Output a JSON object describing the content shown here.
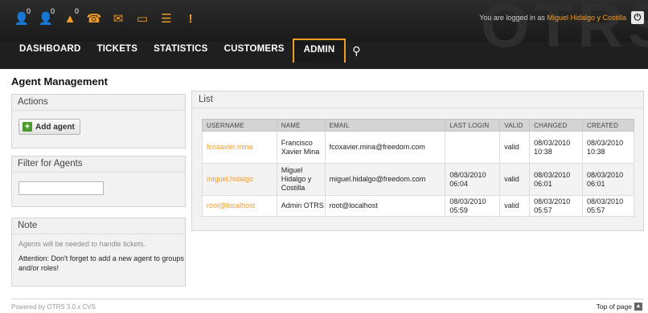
{
  "header": {
    "watermark": "OTRS",
    "login_prefix": "You are logged in as",
    "login_user": "Miguel Hidalgo y Costilla",
    "logout_icon": "power-icon",
    "toolbar": [
      {
        "icon": "locked-tickets-icon",
        "glyph": "👤",
        "count": "0"
      },
      {
        "icon": "watched-tickets-icon",
        "glyph": "👤",
        "count": "0"
      },
      {
        "icon": "responsible-tickets-icon",
        "glyph": "▲",
        "count": "0"
      },
      {
        "icon": "phone-ticket-icon",
        "glyph": "☎",
        "count": ""
      },
      {
        "icon": "email-ticket-icon",
        "glyph": "✉",
        "count": ""
      },
      {
        "icon": "ticket-search-icon",
        "glyph": "▭",
        "count": ""
      },
      {
        "icon": "queue-view-icon",
        "glyph": "☰",
        "count": ""
      },
      {
        "icon": "escalation-icon",
        "glyph": "!",
        "count": ""
      }
    ]
  },
  "nav": {
    "items": [
      "DASHBOARD",
      "TICKETS",
      "STATISTICS",
      "CUSTOMERS",
      "ADMIN"
    ],
    "selected": "ADMIN",
    "search_icon": "search-icon"
  },
  "page": {
    "title": "Agent Management"
  },
  "sidebar": {
    "actions_title": "Actions",
    "add_agent_label": "Add agent",
    "filter_title": "Filter for Agents",
    "filter_value": "",
    "note_title": "Note",
    "note_text": "Agents will be needed to handle tickets.",
    "note_attention": "Attention: Don't forget to add a new agent to groups and/or roles!"
  },
  "list": {
    "title": "List",
    "columns": [
      "USERNAME",
      "NAME",
      "EMAIL",
      "LAST LOGIN",
      "VALID",
      "CHANGED",
      "CREATED"
    ],
    "rows": [
      {
        "username": "fcoxavier.mina",
        "name": "Francisco Xavier Mina",
        "email": "fcoxavier.mina@freedom.com",
        "last_login": "",
        "valid": "valid",
        "changed": "08/03/2010 10:38",
        "created": "08/03/2010 10:38"
      },
      {
        "username": "miguel.hidalgo",
        "name": "Miguel Hidalgo y Costilla",
        "email": "miguel.hidalgo@freedom.com",
        "last_login": "08/03/2010 06:04",
        "valid": "valid",
        "changed": "08/03/2010 06:01",
        "created": "08/03/2010 06:01"
      },
      {
        "username": "root@localhost",
        "name": "Admin OTRS",
        "email": "root@localhost",
        "last_login": "08/03/2010 05:59",
        "valid": "valid",
        "changed": "08/03/2010 05:57",
        "created": "08/03/2010 05:57"
      }
    ]
  },
  "footer": {
    "powered": "Powered by OTRS 3.0.x CVS",
    "top_of_page": "Top of page"
  },
  "colors": {
    "accent": "#f29c28",
    "header_bg": "#1f1f1f"
  }
}
